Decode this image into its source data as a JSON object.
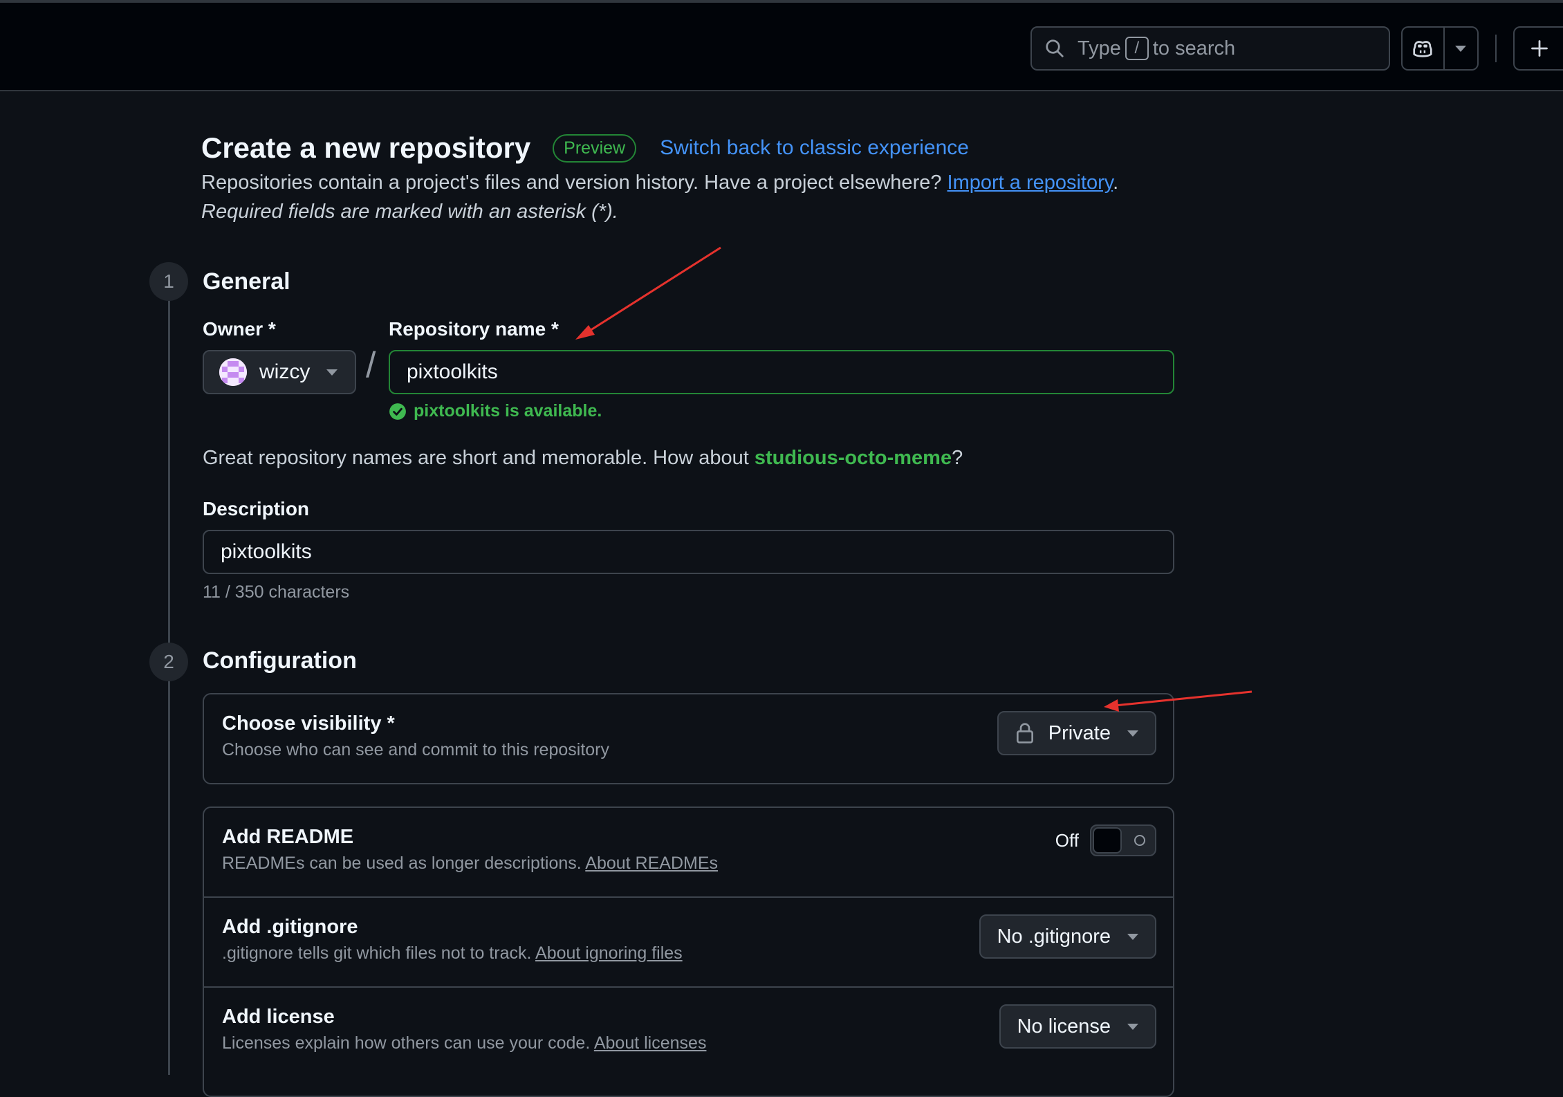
{
  "header": {
    "search": {
      "prefix": "Type",
      "key": "/",
      "suffix": "to search"
    }
  },
  "page": {
    "title": "Create a new repository",
    "badge": "Preview",
    "switch_link": "Switch back to classic experience",
    "description": "Repositories contain a project's files and version history. Have a project elsewhere?",
    "import_link": "Import a repository",
    "required_note": "Required fields are marked with an asterisk (*)."
  },
  "general": {
    "step": "1",
    "title": "General",
    "owner_label": "Owner *",
    "owner_value": "wizcy",
    "repo_label": "Repository name *",
    "repo_value": "pixtoolkits",
    "availability": "pixtoolkits is available.",
    "suggestion_prefix": "Great repository names are short and memorable. How about",
    "suggestion_name": "studious-octo-meme",
    "suggestion_suffix": "?",
    "description_label": "Description",
    "description_value": "pixtoolkits",
    "char_count": "11 / 350 characters"
  },
  "configuration": {
    "step": "2",
    "title": "Configuration",
    "visibility": {
      "title": "Choose visibility *",
      "subtitle": "Choose who can see and commit to this repository",
      "value": "Private"
    },
    "readme": {
      "title": "Add README",
      "subtitle": "READMEs can be used as longer descriptions.",
      "link": "About READMEs",
      "toggle_label": "Off"
    },
    "gitignore": {
      "title": "Add .gitignore",
      "subtitle": ".gitignore tells git which files not to track.",
      "link": "About ignoring files",
      "value": "No .gitignore"
    },
    "license": {
      "title": "Add license",
      "subtitle": "Licenses explain how others can use your code.",
      "link": "About licenses",
      "value": "No license"
    }
  },
  "colors": {
    "background": "#0d1117",
    "accent_blue": "#4493f8",
    "success_green": "#3fb950",
    "annotation_red": "#e5322d"
  },
  "icons": [
    "search-icon",
    "copilot-icon",
    "chevron-down-icon",
    "plus-icon",
    "check-circle-icon",
    "lock-icon"
  ]
}
